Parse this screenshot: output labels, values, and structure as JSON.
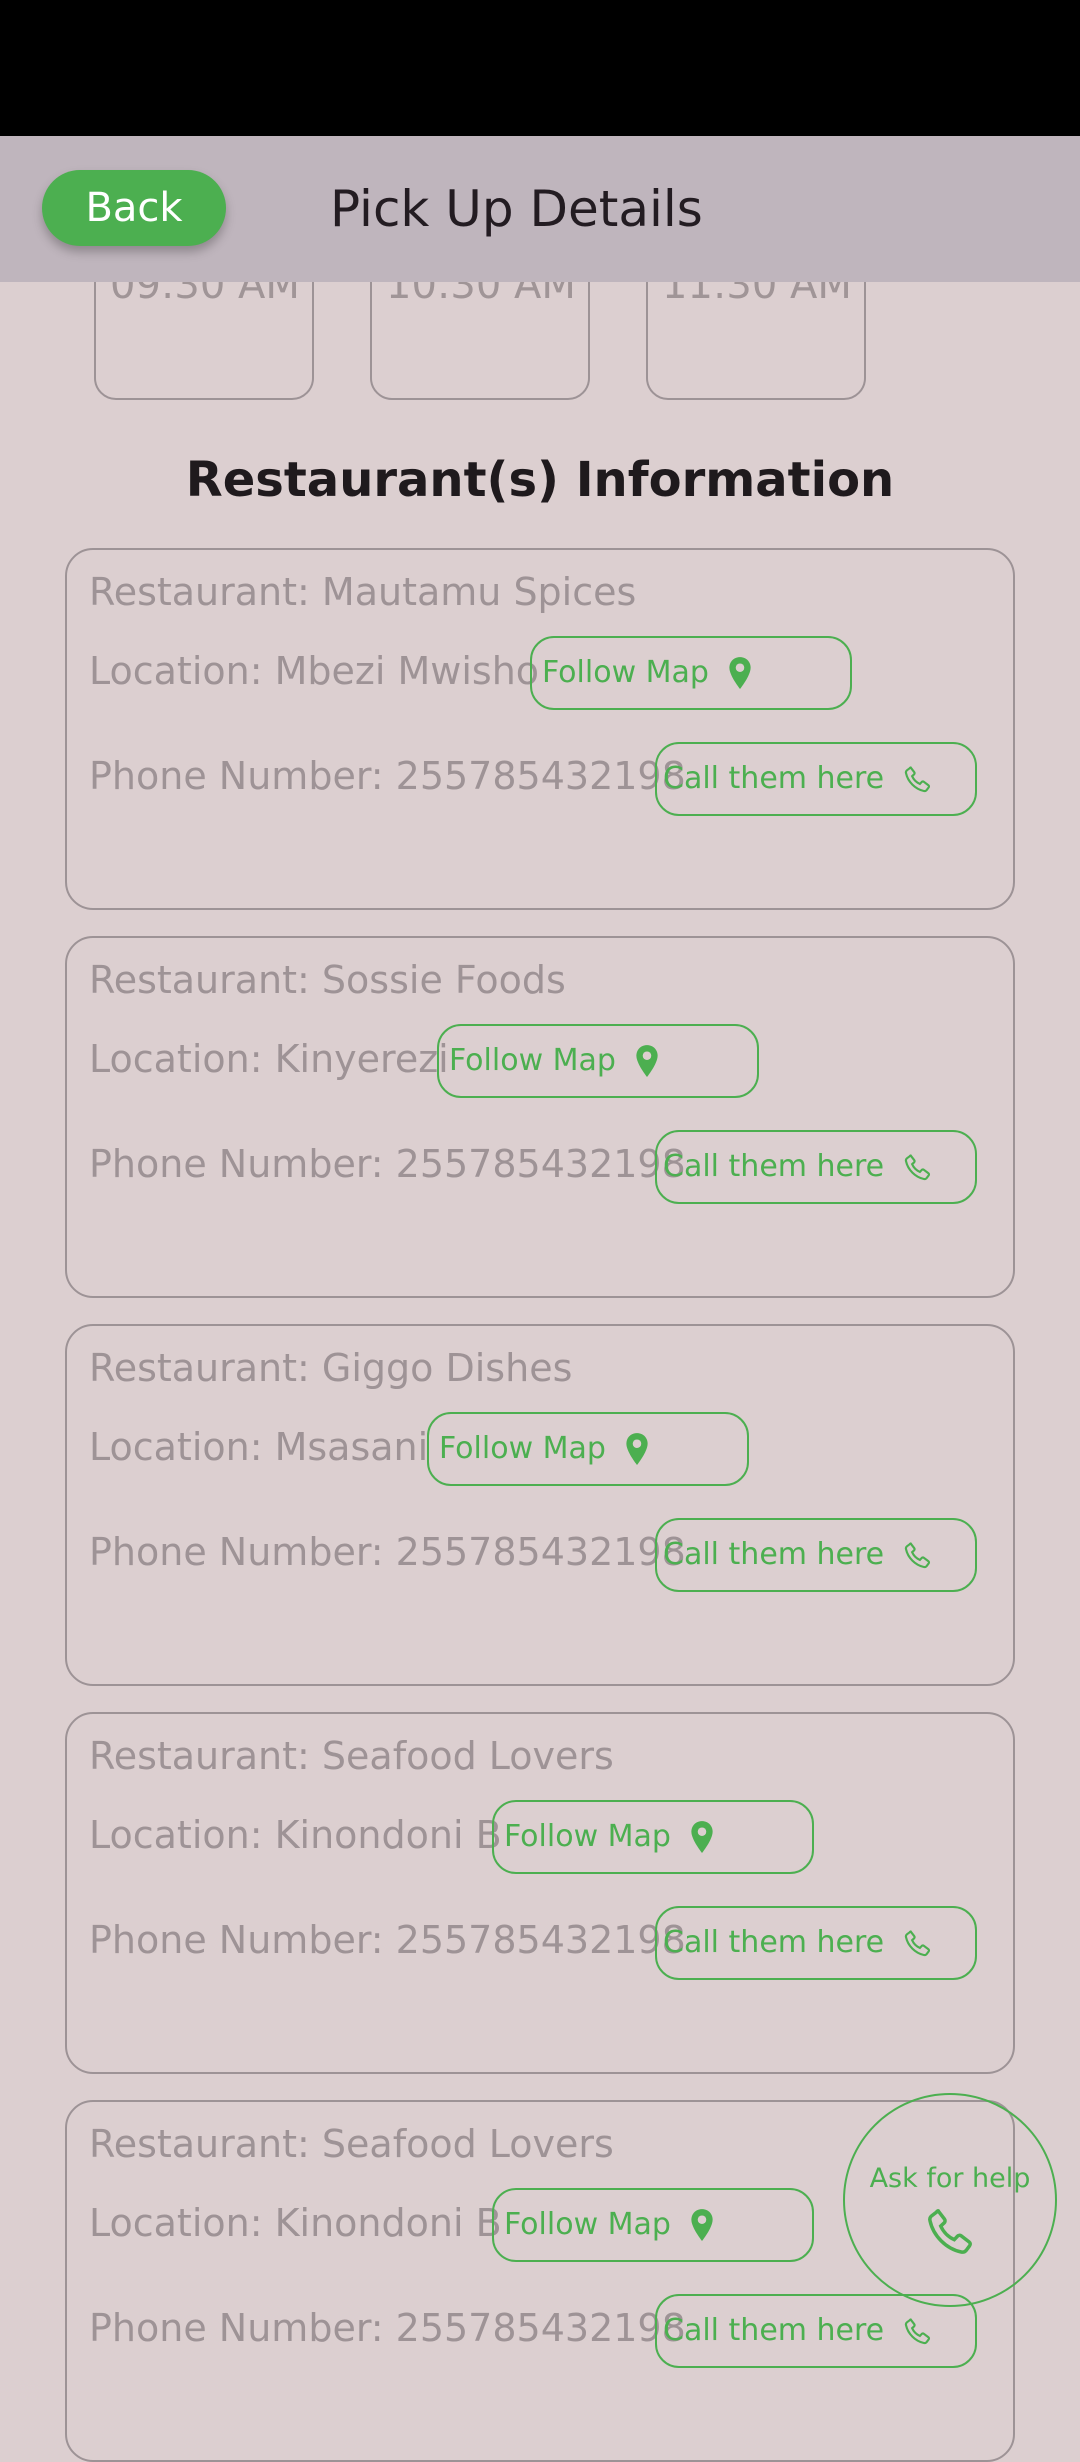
{
  "header": {
    "back_label": "Back",
    "title": "Pick Up Details"
  },
  "time_slots": [
    "09:30 AM",
    "10:30 AM",
    "11:30 AM"
  ],
  "section_title": "Restaurant(s) Information",
  "buttons": {
    "follow_map": "Follow Map",
    "call": "Call them here"
  },
  "restaurants": [
    {
      "name": "Restaurant: Mautamu Spices",
      "location": "Location: Mbezi Mwisho",
      "phone": "Phone Number: 255785432198"
    },
    {
      "name": "Restaurant: Sossie Foods",
      "location": "Location: Kinyerezi",
      "phone": "Phone Number: 255785432198"
    },
    {
      "name": "Restaurant: Giggo Dishes",
      "location": "Location: Msasani",
      "phone": "Phone Number: 255785432198"
    },
    {
      "name": "Restaurant: Seafood Lovers",
      "location": "Location: Kinondoni B",
      "phone": "Phone Number: 255785432198"
    },
    {
      "name": "Restaurant: Seafood Lovers",
      "location": "Location: Kinondoni B",
      "phone": "Phone Number: 255785432198"
    }
  ],
  "help_fab": {
    "label": "Ask for help",
    "icon": "phone-icon"
  },
  "icons": {
    "map": "location-pin-icon",
    "call": "phone-icon"
  },
  "colors": {
    "accent": "#4caf50",
    "background": "#dccfd0",
    "appbar": "#bfb5bd",
    "muted_text": "#9e9396"
  }
}
